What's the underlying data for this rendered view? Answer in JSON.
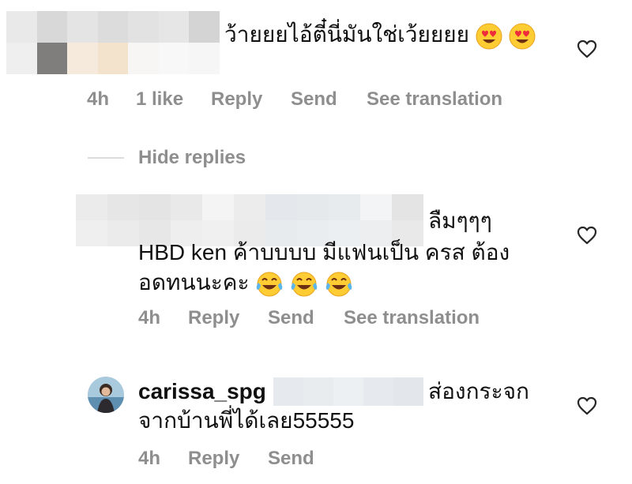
{
  "comment1": {
    "text": "ว้ายยยไอ้ตี๋นี่มันใช่เว้ยยยย",
    "emojis": [
      "heart-eyes",
      "heart-eyes"
    ],
    "meta": {
      "time": "4h",
      "likes": "1 like",
      "reply": "Reply",
      "send": "Send",
      "translate": "See translation"
    }
  },
  "hide_replies": "Hide replies",
  "reply1": {
    "text_line1": "ลืมๆๆๆ",
    "text_line2": "HBD ken ค้าบบบบ มีแฟนเป็น ครส ต้อง",
    "text_line3": "อดทนนะคะ",
    "emojis": [
      "tears-of-joy",
      "tears-of-joy",
      "tears-of-joy"
    ],
    "meta": {
      "time": "4h",
      "reply": "Reply",
      "send": "Send",
      "translate": "See translation"
    }
  },
  "reply2": {
    "username": "carissa_spg",
    "text_line1": "ส่องกระจก",
    "text_line2": "จากบ้านพี่ได้เลย55555",
    "meta": {
      "time": "4h",
      "reply": "Reply",
      "send": "Send"
    }
  },
  "icons": {
    "like": "heart-outline-icon"
  },
  "colors": {
    "meta_gray": "#8e8e8e",
    "divider": "#dbdbdb",
    "text": "#111111"
  }
}
